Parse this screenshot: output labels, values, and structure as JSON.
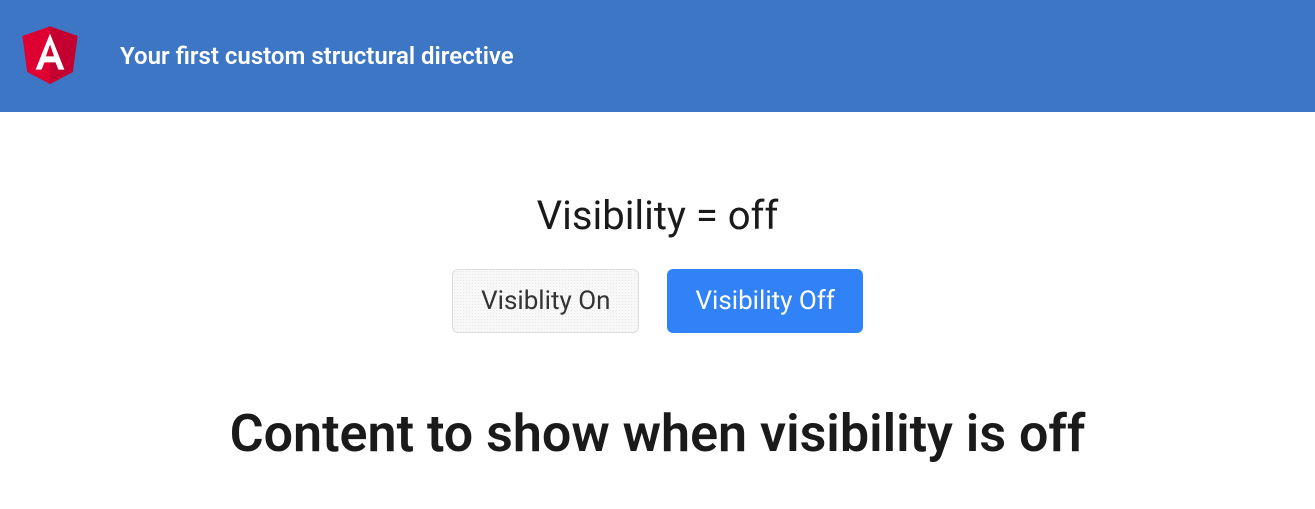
{
  "header": {
    "title": "Your first custom structural directive"
  },
  "main": {
    "status_label": "Visibility = off",
    "buttons": {
      "on_label": "Visiblity On",
      "off_label": "Visibility Off"
    },
    "content_message": "Content to show when visibility is off"
  },
  "colors": {
    "header_bg": "#3d76c5",
    "primary_button": "#3182f6",
    "logo_red": "#dd0031"
  }
}
